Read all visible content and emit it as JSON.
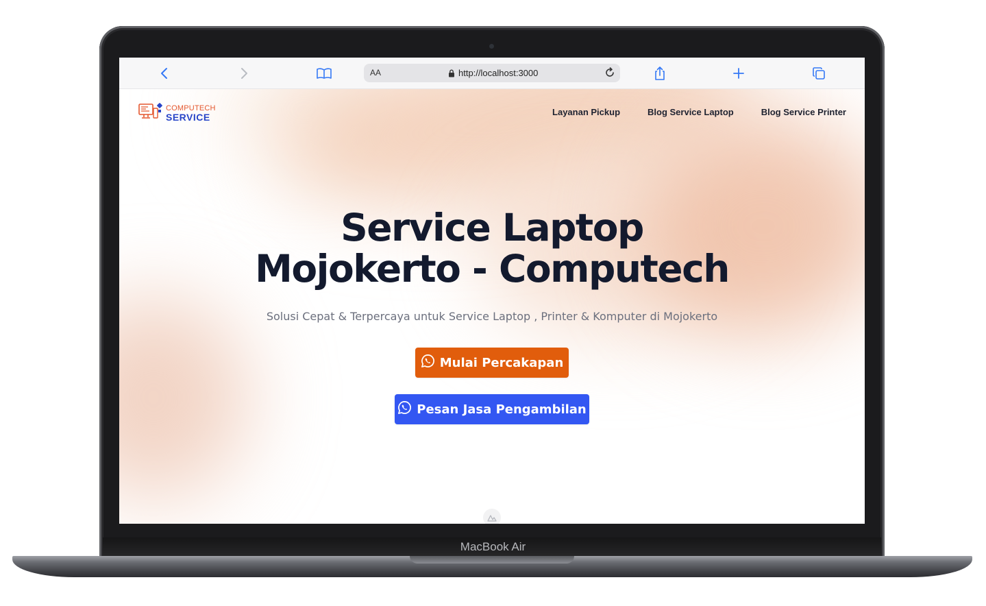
{
  "device": {
    "model_label": "MacBook Air"
  },
  "browser": {
    "text_size_label": "AA",
    "url": "http://localhost:3000",
    "icons": [
      "back-icon",
      "forward-icon",
      "bookmarks-icon",
      "lock-icon",
      "reload-icon",
      "share-icon",
      "new-tab-icon",
      "tabs-icon"
    ]
  },
  "site": {
    "logo": {
      "line1": "COMPUTECH",
      "line2": "SERVICE"
    },
    "nav": [
      {
        "label": "Layanan Pickup"
      },
      {
        "label": "Blog Service Laptop"
      },
      {
        "label": "Blog Service Printer"
      }
    ],
    "hero": {
      "title_line1": "Service Laptop",
      "title_line2": "Mojokerto - Computech",
      "subtitle": "Solusi Cepat & Terpercaya untuk Service Laptop , Printer & Komputer di Mojokerto",
      "primary_button": "Mulai Percakapan",
      "secondary_button": "Pesan Jasa Pengambilan"
    }
  },
  "colors": {
    "primary_button": "#e15d0c",
    "secondary_button": "#3357f2",
    "heading": "#131a2e",
    "logo_orange": "#e4572e",
    "logo_blue": "#2845c8"
  }
}
